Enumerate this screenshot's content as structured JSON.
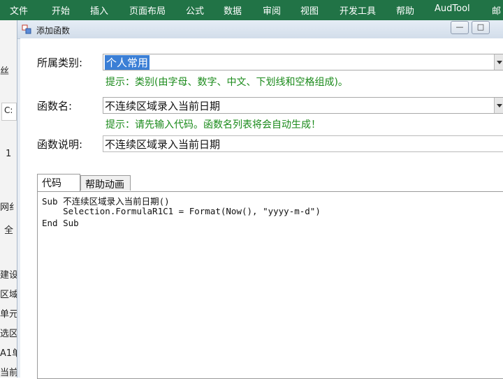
{
  "ribbon": {
    "tabs": [
      "文件",
      "开始",
      "插入",
      "页面布局",
      "公式",
      "数据",
      "审阅",
      "视图",
      "开发工具",
      "帮助",
      "AudTool",
      "邮"
    ]
  },
  "background": {
    "fragments": [
      "丝",
      "C:",
      "1",
      "网纟",
      "全",
      "建设",
      "区域",
      "单元",
      "选区",
      "A1单",
      "当前"
    ]
  },
  "dialog": {
    "title": "添加函数",
    "window_buttons": [
      "—",
      "□"
    ],
    "category_label": "所属类别:",
    "category_value": "个人常用",
    "category_hint": "提示：类别(由字母、数字、中文、下划线和空格组成)。",
    "function_name_label": "函数名:",
    "function_name_value": "不连续区域录入当前日期",
    "function_name_hint": "提示：请先输入代码。函数名列表将会自动生成！",
    "description_label": "函数说明:",
    "description_value": "不连续区域录入当前日期",
    "tabs": [
      "代码",
      "帮助动画"
    ],
    "code_lines": [
      "Sub 不连续区域录入当前日期()",
      "    Selection.FormulaR1C1 = Format(Now(), \"yyyy-m-d\")",
      "End Sub"
    ]
  },
  "colors": {
    "ribbon": "#217346",
    "hint_text": "#1a8a1a",
    "selection": "#3b7fd6"
  }
}
